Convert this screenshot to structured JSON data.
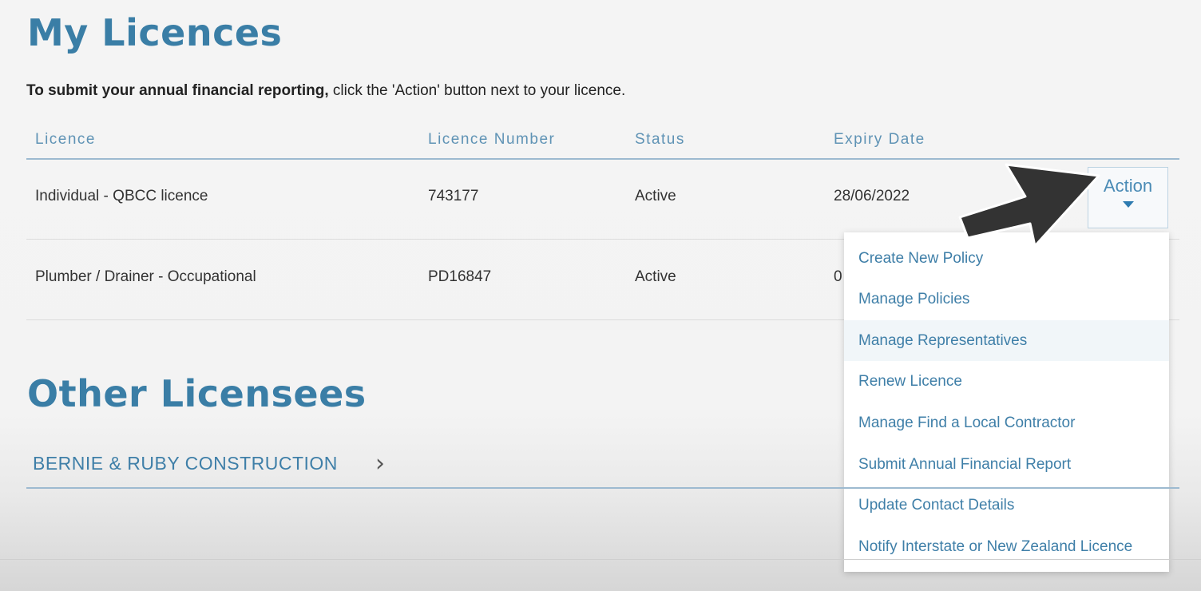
{
  "my_licences": {
    "title": "My Licences",
    "intro_bold": "To submit your annual financial reporting,",
    "intro_rest": " click the 'Action' button next to your licence."
  },
  "table": {
    "headers": {
      "licence": "Licence",
      "licence_number": "Licence Number",
      "status": "Status",
      "expiry_date": "Expiry Date"
    },
    "rows": [
      {
        "licence": "Individual - QBCC licence",
        "number": "743177",
        "status": "Active",
        "expiry": "28/06/2022"
      },
      {
        "licence": "Plumber / Drainer - Occupational",
        "number": "PD16847",
        "status": "Active",
        "expiry": "0"
      }
    ]
  },
  "action_button": {
    "label": "Action",
    "icon": "caret-down-icon"
  },
  "action_menu": {
    "items": [
      "Create New Policy",
      "Manage Policies",
      "Manage Representatives",
      "Renew Licence",
      "Manage Find a Local Contractor",
      "Submit Annual Financial Report",
      "Update Contact Details",
      "Notify Interstate or New Zealand Licence"
    ],
    "highlighted_index": 2
  },
  "other_licensees": {
    "title": "Other Licensees",
    "items": [
      {
        "name": "BERNIE & RUBY CONSTRUCTION",
        "icon": "chevron-right-icon"
      }
    ]
  },
  "colors": {
    "heading": "#3a7ea6",
    "link": "#3f7fa8",
    "arrow": "#333333"
  }
}
